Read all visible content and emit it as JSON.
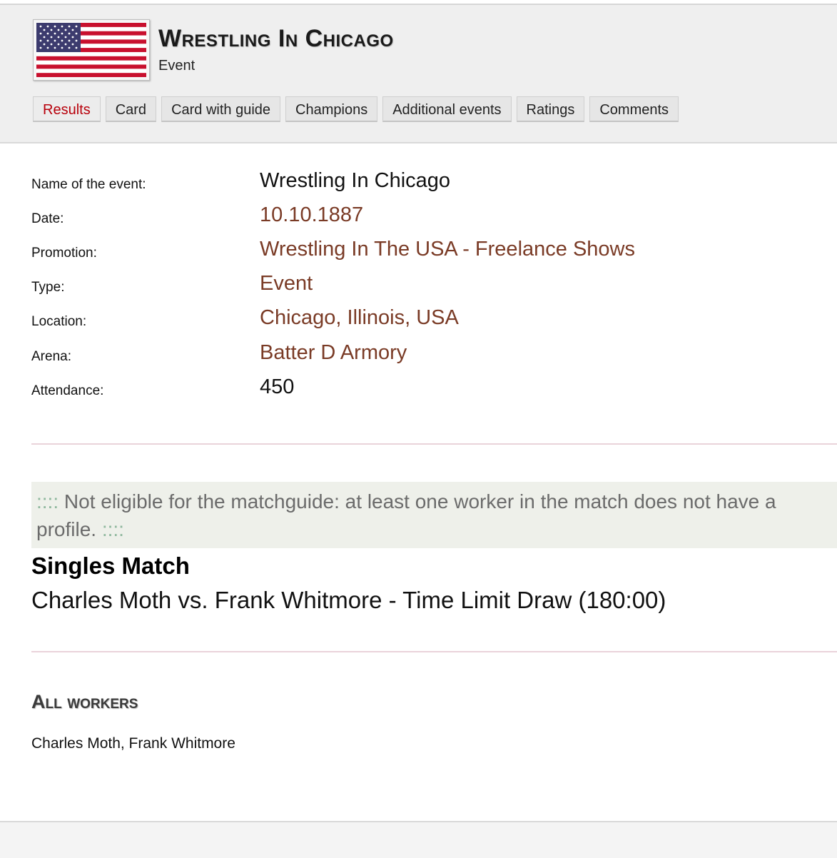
{
  "header": {
    "title": "Wrestling In Chicago",
    "subtitle": "Event",
    "flag_icon": "usa-flag-icon"
  },
  "tabs": [
    {
      "label": "Results",
      "active": true
    },
    {
      "label": "Card",
      "active": false
    },
    {
      "label": "Card with guide",
      "active": false
    },
    {
      "label": "Champions",
      "active": false
    },
    {
      "label": "Additional events",
      "active": false
    },
    {
      "label": "Ratings",
      "active": false
    },
    {
      "label": "Comments",
      "active": false
    }
  ],
  "info": [
    {
      "label": "Name of the event:",
      "value": "Wrestling In Chicago",
      "link": false
    },
    {
      "label": "Date:",
      "value": "10.10.1887",
      "link": true
    },
    {
      "label": "Promotion:",
      "value": "Wrestling In The USA - Freelance Shows",
      "link": true
    },
    {
      "label": "Type:",
      "value": "Event",
      "link": true
    },
    {
      "label": "Location:",
      "value": "Chicago, Illinois, USA",
      "link": true
    },
    {
      "label": "Arena:",
      "value": "Batter D Armory",
      "link": true
    },
    {
      "label": "Attendance:",
      "value": "450",
      "link": false
    }
  ],
  "notice": {
    "prefix": "::::",
    "text": " Not eligible for the matchguide: at least one worker in the match does not have a profile. ",
    "suffix": "::::"
  },
  "match": {
    "type": "Singles Match",
    "result": "Charles Moth vs. Frank Whitmore - Time Limit Draw (180:00)"
  },
  "workers": {
    "heading": "All workers",
    "list": "Charles Moth, Frank Whitmore"
  },
  "colors": {
    "link": "#7a3b26",
    "active_tab": "#b8000b",
    "notice_dots": "#8eb79d"
  }
}
